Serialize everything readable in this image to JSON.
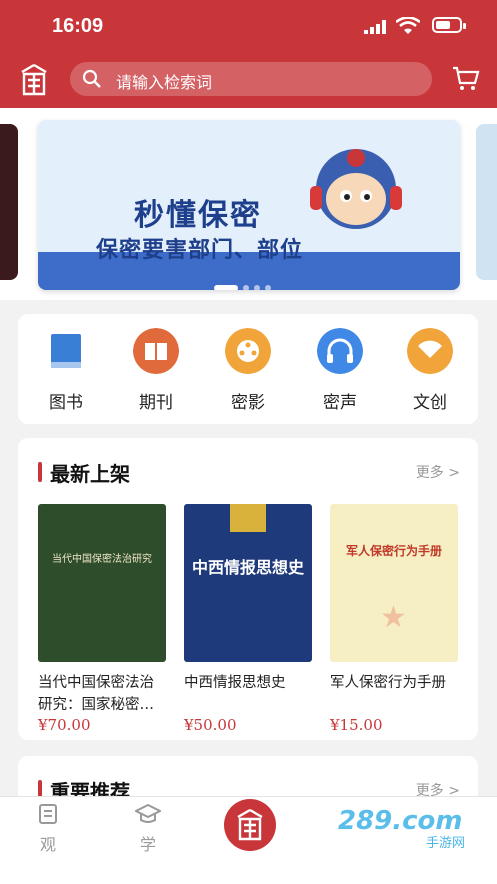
{
  "status": {
    "time": "16:09"
  },
  "search": {
    "placeholder": "请输入检索词"
  },
  "banner": {
    "line1": "秒懂保密",
    "line2": "保密要害部门、部位"
  },
  "categories": [
    {
      "label": "图书",
      "icon": "book-icon",
      "color": "#3a7fd6"
    },
    {
      "label": "期刊",
      "icon": "journal-icon",
      "color": "#e06a3c"
    },
    {
      "label": "密影",
      "icon": "film-icon",
      "color": "#f0a43a"
    },
    {
      "label": "密声",
      "icon": "headphones-icon",
      "color": "#3f88e6"
    },
    {
      "label": "文创",
      "icon": "fan-icon",
      "color": "#f0a43a"
    }
  ],
  "new_arrivals": {
    "title": "最新上架",
    "more": "更多 >",
    "books": [
      {
        "name": "当代中国保密法治研究：国家秘密…",
        "price": "¥70.00",
        "cover_title": "当代中国保密法治研究",
        "cover_color": "#2e4d2a"
      },
      {
        "name": "中西情报思想史",
        "price": "¥50.00",
        "cover_title": "中西情报思想史",
        "cover_color": "#1f3a7a"
      },
      {
        "name": "军人保密行为手册",
        "price": "¥15.00",
        "cover_title": "军人保密行为手册",
        "cover_color": "#f6efc4"
      }
    ]
  },
  "recommended": {
    "title": "重要推荐",
    "more": "更多 >"
  },
  "tabs": [
    {
      "label": "观",
      "icon": "document-icon"
    },
    {
      "label": "学",
      "icon": "graduation-cap-icon"
    }
  ],
  "watermark": {
    "main": "289.com",
    "sub": "手游网"
  },
  "colors": {
    "brand": "#c8363a",
    "price": "#c8363a"
  }
}
